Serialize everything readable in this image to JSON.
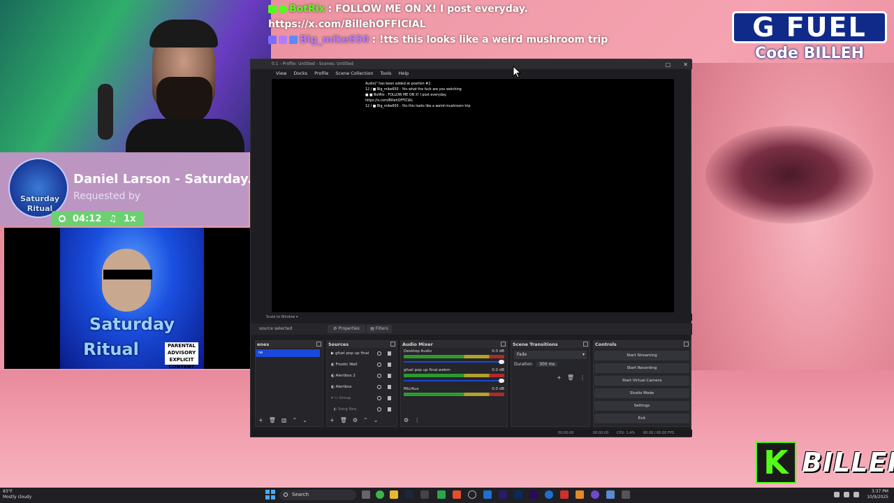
{
  "chat": [
    {
      "user": "BotRix",
      "user_color": "#53fc18",
      "message": ": FOLLOW ME ON X! I post everyday."
    },
    {
      "user": "",
      "user_color": "#ffffff",
      "message": "https://x.com/BillehOFFICIAL"
    },
    {
      "user": "Big_mike650",
      "user_color": "#b27cff",
      "message": ": !tts this looks like a weird mushroom trip"
    }
  ],
  "sponsor": {
    "brand": "G FUEL",
    "code": "Code BILLEH"
  },
  "now_playing": {
    "title": "Daniel Larson - Saturday...",
    "requested_by": "Requested by",
    "avatar_text_1": "Saturday",
    "avatar_text_2": "Ritual",
    "duration": "04:12",
    "count": "1x"
  },
  "album": {
    "title_1": "Saturday",
    "title_2": "Ritual",
    "advisory": "PARENTAL ADVISORY EXPLICIT CONTENT"
  },
  "obs": {
    "title": "0.1 - Profile: Untitled - Scenes: Untitled",
    "menu": [
      "View",
      "Docks",
      "Profile",
      "Scene Collection",
      "Tools",
      "Help"
    ],
    "preview_chat": [
      "Audio)\" has been added at position #2.",
      "12 / ■ Big_mike650 : !tts what the fuck are you watching",
      "■ ■ BotRix : FOLLOW ME ON X! I post everyday.",
      "https://x.com/BillehOFFICIAL",
      "12 / ■ Big_mike650 : !tts this looks like a weird mushroom trip"
    ],
    "scale_label": "Scale to Window",
    "no_source": "source selected",
    "properties": "Properties",
    "filters": "Filters",
    "docks": {
      "scenes": "enes",
      "sources": "Sources",
      "audio_mixer": "Audio Mixer",
      "scene_transitions": "Scene Transitions",
      "controls": "Controls"
    },
    "scene_selected": "ne",
    "sources": [
      "gfuel pop up final",
      "Frostic Wall",
      "Alertbox 2",
      "Alertbox",
      "Group",
      "Song Req"
    ],
    "mixer": [
      {
        "name": "Desktop Audio",
        "level": "0.0 dB"
      },
      {
        "name": "gfuel pop up final.webm",
        "level": "0.0 dB"
      },
      {
        "name": "Mic/Aux",
        "level": "0.0 dB"
      }
    ],
    "transition": {
      "type": "Fade",
      "duration_label": "Duration",
      "duration": "300 ms"
    },
    "controls": [
      "Start Streaming",
      "Start Recording",
      "Start Virtual Camera",
      "Studio Mode",
      "Settings",
      "Exit"
    ],
    "status": {
      "stream_time": "00:00:00",
      "rec_time": "00:00:00",
      "cpu": "CPU: 1.4%",
      "fps": "60.00 / 60.00 FPS"
    }
  },
  "branding": {
    "k": "K",
    "name": "BILLEH"
  },
  "taskbar": {
    "weather_temp": "83°F",
    "weather_desc": "Mostly cloudy",
    "search": "Search",
    "time": "3:37 PM",
    "date": "10/9/2025"
  }
}
